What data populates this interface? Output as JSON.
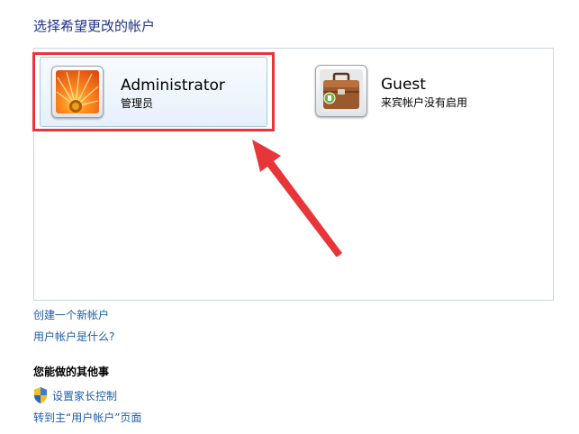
{
  "page": {
    "title": "选择希望更改的帐户"
  },
  "accounts": [
    {
      "name": "Administrator",
      "role": "管理员",
      "selected": true,
      "icon": "flower-avatar-icon"
    },
    {
      "name": "Guest",
      "role": "来宾帐户没有启用",
      "selected": false,
      "icon": "briefcase-avatar-icon"
    }
  ],
  "links": {
    "create_account": "创建一个新帐户",
    "what_is_account": "用户帐户是什么?"
  },
  "other_tasks": {
    "heading": "您能做的其他事",
    "parental_controls": "设置家长控制",
    "go_to_main": "转到主“用户帐户”页面",
    "shield_icon": "uac-shield-icon"
  },
  "colors": {
    "link": "#1e5ca8",
    "title": "#1e3287",
    "annotation": "#e8353a",
    "selection": "#a9c9ea"
  }
}
